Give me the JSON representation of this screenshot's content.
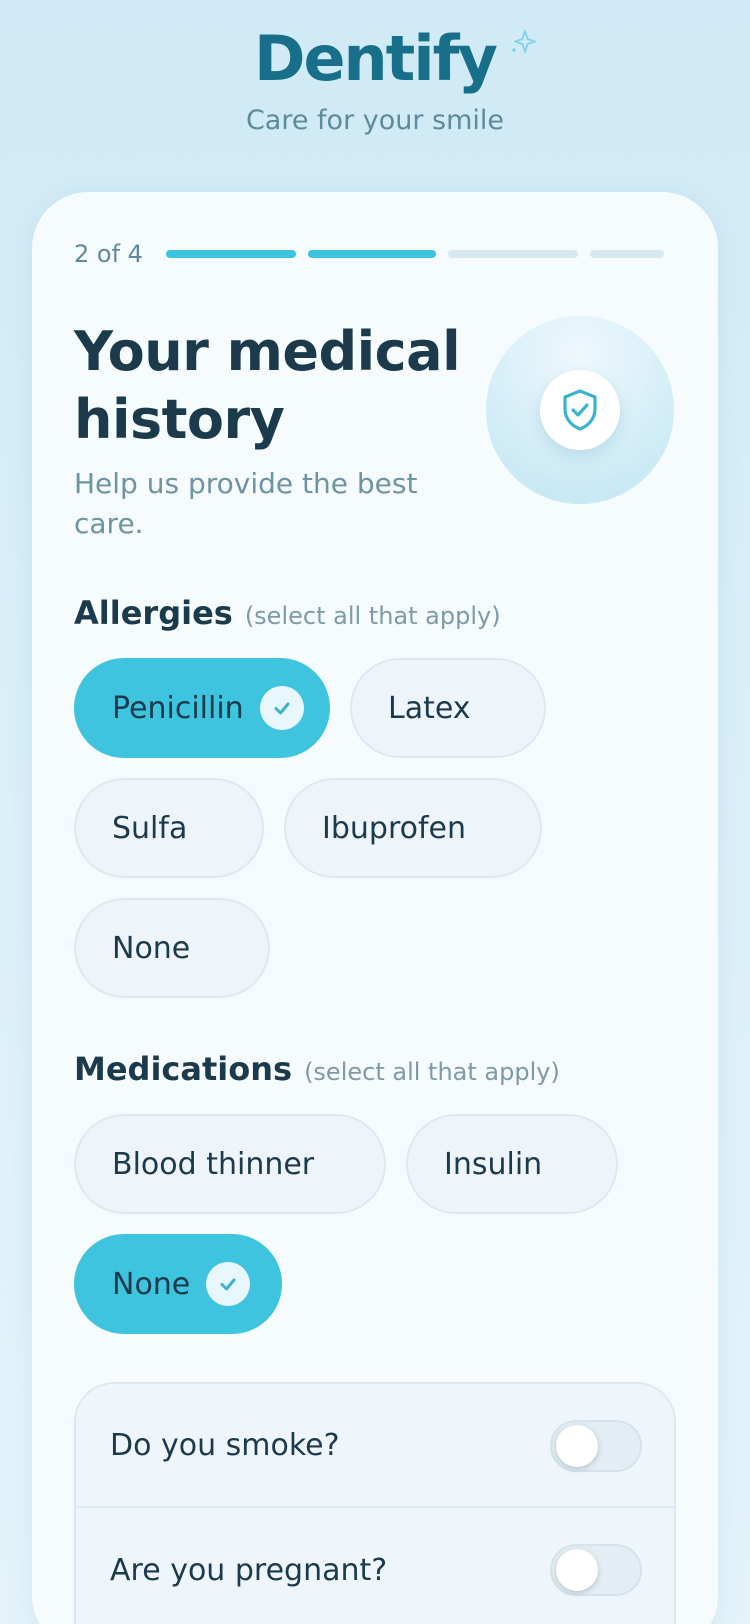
{
  "brand": {
    "title": "Dentify",
    "tagline": "Care for your smile",
    "icon": "sparkle-icon"
  },
  "progress": {
    "label": "2 of 4",
    "current": 2,
    "total": 4
  },
  "page": {
    "title": "Your medical history",
    "subtitle": "Help us provide the best care.",
    "hero_icon": "shield-check-icon"
  },
  "allergies": {
    "title": "Allergies",
    "hint": "(select all that apply)",
    "options": [
      {
        "label": "Penicillin",
        "selected": true
      },
      {
        "label": "Latex",
        "selected": false
      },
      {
        "label": "Sulfa",
        "selected": false
      },
      {
        "label": "Ibuprofen",
        "selected": false
      },
      {
        "label": "None",
        "selected": false
      }
    ]
  },
  "medications": {
    "title": "Medications",
    "hint": "(select all that apply)",
    "options": [
      {
        "label": "Blood thinner",
        "selected": false
      },
      {
        "label": "Insulin",
        "selected": false
      },
      {
        "label": "None",
        "selected": true
      }
    ]
  },
  "questions": [
    {
      "label": "Do you smoke?",
      "on": false
    },
    {
      "label": "Are you pregnant?",
      "on": false
    }
  ],
  "colors": {
    "accent": "#3ec4df",
    "brand": "#176f8a",
    "text": "#1b3a4b"
  }
}
